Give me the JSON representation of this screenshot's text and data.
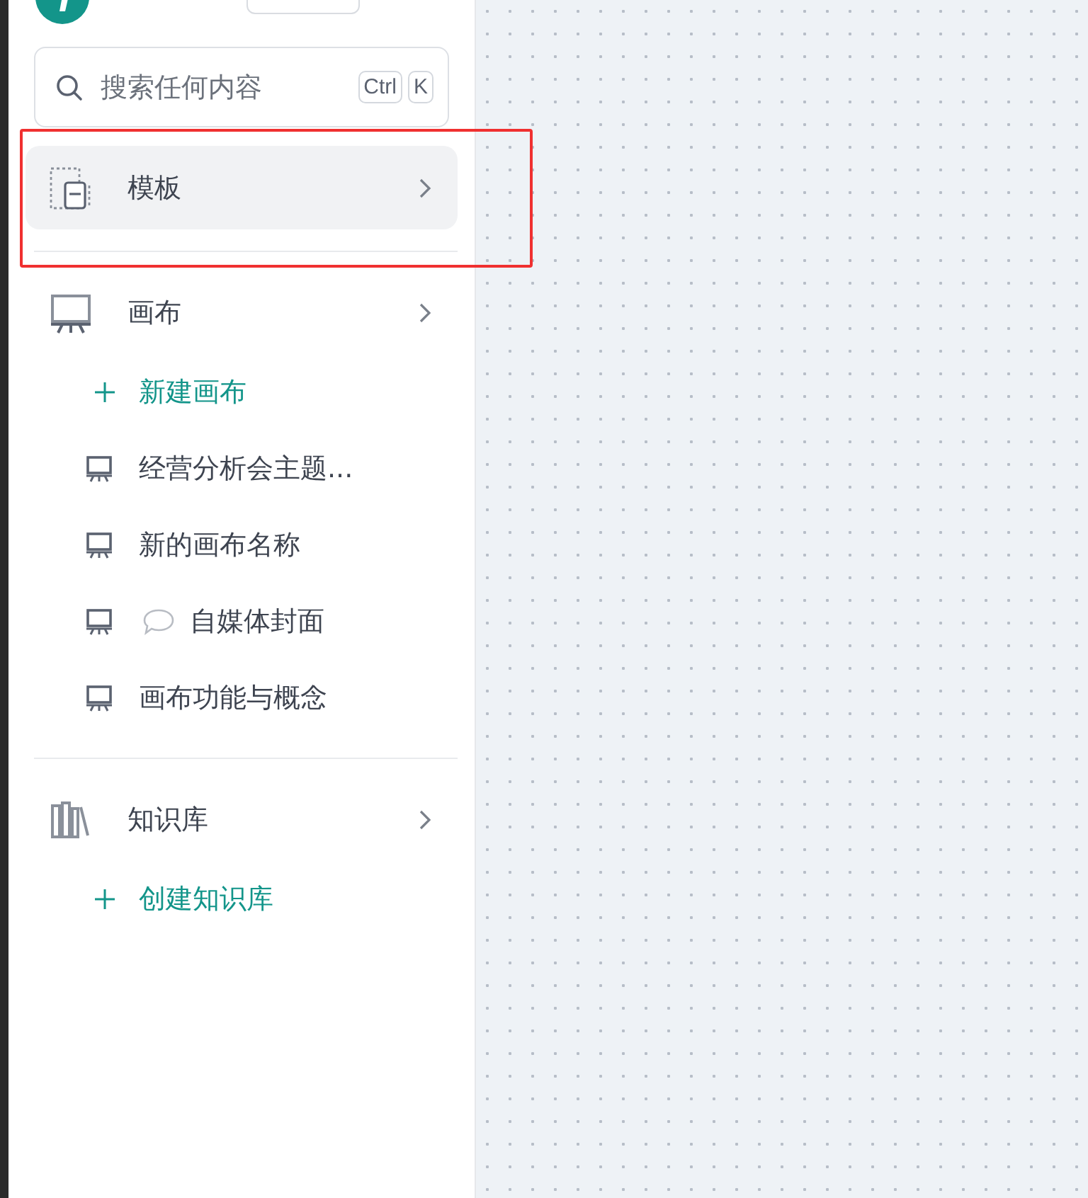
{
  "search": {
    "placeholder": "搜索任何内容",
    "keys": [
      "Ctrl",
      "K"
    ]
  },
  "sections": [
    {
      "kind": "templates",
      "label": "模板",
      "selected": true
    },
    {
      "kind": "canvas",
      "label": "画布",
      "selected": false,
      "action": "新建画布",
      "items": [
        {
          "label": "经营分析会主题...",
          "comment": false
        },
        {
          "label": "新的画布名称",
          "comment": false
        },
        {
          "label": "自媒体封面",
          "comment": true
        },
        {
          "label": "画布功能与概念",
          "comment": false
        }
      ]
    },
    {
      "kind": "library",
      "label": "知识库",
      "selected": false,
      "action": "创建知识库"
    }
  ]
}
